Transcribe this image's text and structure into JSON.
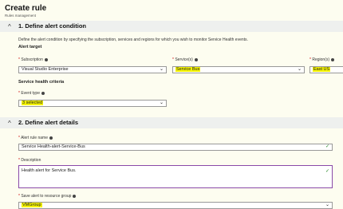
{
  "page": {
    "title": "Create rule",
    "subtitle": "Rules management"
  },
  "section1": {
    "chevron": "^",
    "title": "1. Define alert condition",
    "description": "Define the alert condition by specifying the subscription, services and regions for which you wish to monitor Service Health events.",
    "alert_target_label": "Alert target",
    "subscription": {
      "label": "Subscription",
      "value": "Visual Studio Enterprise"
    },
    "services": {
      "label": "Service(s)",
      "value": "Service Bus"
    },
    "regions": {
      "label": "Region(s)",
      "value": "East US"
    },
    "criteria_label": "Service health criteria",
    "event_type": {
      "label": "Event type",
      "value": "3 selected"
    }
  },
  "section2": {
    "chevron": "^",
    "title": "2. Define alert details",
    "rule_name": {
      "label": "Alert rule name",
      "value": "Service Health-alert-Service-Bus"
    },
    "description": {
      "label": "Description",
      "value": "Health alert for Service Bus."
    },
    "resource_group": {
      "label": "Save alert to resource group",
      "value": "VMGroup"
    }
  },
  "colors": {
    "highlight": "#f4f300",
    "background": "#fdfdf0",
    "section_header": "#eef0ee",
    "description_border": "#8a4aa8",
    "check": "#2a8a2a"
  }
}
